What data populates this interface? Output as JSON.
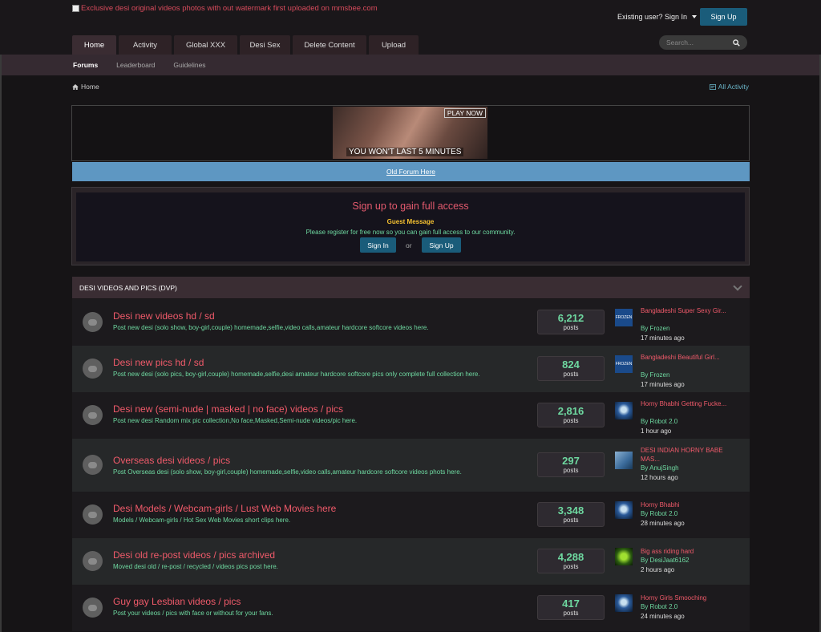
{
  "header": {
    "logo_alt": "Exclusive desi original videos photos with out watermark first uploaded on mmsbee.com",
    "existing_user": "Existing user? Sign In",
    "signup": "Sign Up",
    "search_placeholder": "Search..."
  },
  "tabs": [
    "Home",
    "Activity",
    "Global XXX",
    "Desi Sex",
    "Delete Content",
    "Upload"
  ],
  "subnav": [
    "Forums",
    "Leaderboard",
    "Guidelines"
  ],
  "breadcrumb": {
    "home": "Home",
    "all_activity": "All Activity"
  },
  "ad": {
    "play": "PLAY NOW",
    "tagline": "YOU WON'T LAST 5 MINUTES"
  },
  "old_forum": "Old Forum Here",
  "notice": {
    "title": "Sign up to gain full access",
    "subtitle": "Guest Message",
    "text": "Please register for free now so you can gain full access to our community.",
    "signin": "Sign In",
    "or": "or",
    "signup": "Sign Up"
  },
  "section": {
    "title": "DESI VIDEOS AND PICS (DVP)"
  },
  "forums": [
    {
      "title": "Desi new videos hd / sd",
      "desc": "Post new desi (solo show, boy-girl,couple) homemade,selfie,video calls,amateur hardcore softcore videos here.",
      "posts": "6,212",
      "posts_label": "posts",
      "avatar": "frozen",
      "avatar_text": "FROZEN",
      "last_title": "Bangladeshi Super Sexy Gir...",
      "last_by": "By Frozen",
      "last_time": "17 minutes ago"
    },
    {
      "title": "Desi new pics hd / sd",
      "desc": "Post new desi (solo pics, boy-girl,couple) homemade,selfie,desi amateur hardcore softcore pics only complete full collection here.",
      "posts": "824",
      "posts_label": "posts",
      "avatar": "frozen",
      "avatar_text": "FROZEN",
      "last_title": "Bangladeshi Beautiful Girl...",
      "last_by": "By Frozen",
      "last_time": "17 minutes ago"
    },
    {
      "title": "Desi new (semi-nude | masked | no face) videos / pics",
      "desc": "Post new desi Random mix pic collection,No face,Masked,Semi-nude videos/pic here.",
      "posts": "2,816",
      "posts_label": "posts",
      "avatar": "robot",
      "avatar_text": "",
      "last_title": "Horny Bhabhi Getting Fucke...",
      "last_by": "By Robot 2.0",
      "last_time": "1 hour ago"
    },
    {
      "title": "Overseas desi videos / pics",
      "desc": "Post Overseas desi (solo show, boy-girl,couple) homemade,selfie,video calls,amateur hardcore softcore videos phots here.",
      "posts": "297",
      "posts_label": "posts",
      "avatar": "anuj",
      "avatar_text": "",
      "last_title": "DESI INDIAN HORNY BABE MAS...",
      "last_by": "By AnujSingh",
      "last_time": "12 hours ago"
    },
    {
      "title": "Desi Models / Webcam-girls / Lust Web Movies here",
      "desc": "Models / Webcam-girls / Hot Sex Web Movies short clips here.",
      "posts": "3,348",
      "posts_label": "posts",
      "avatar": "robot",
      "avatar_text": "",
      "last_title": "Horny Bhabhi",
      "last_by": "By Robot 2.0",
      "last_time": "28 minutes ago"
    },
    {
      "title": "Desi old re-post videos / pics archived",
      "desc": "Moved desi old / re-post / recycled / videos pics post here.",
      "posts": "4,288",
      "posts_label": "posts",
      "avatar": "desi",
      "avatar_text": "",
      "last_title": "Big ass riding hard",
      "last_by": "By DesiJaat6162",
      "last_time": "2 hours ago"
    },
    {
      "title": "Guy gay Lesbian videos / pics",
      "desc": "Post your videos / pics with face or without for your fans.",
      "posts": "417",
      "posts_label": "posts",
      "avatar": "robot",
      "avatar_text": "",
      "last_title": "Horny Girls Smooching",
      "last_by": "By Robot 2.0",
      "last_time": "24 minutes ago"
    }
  ]
}
